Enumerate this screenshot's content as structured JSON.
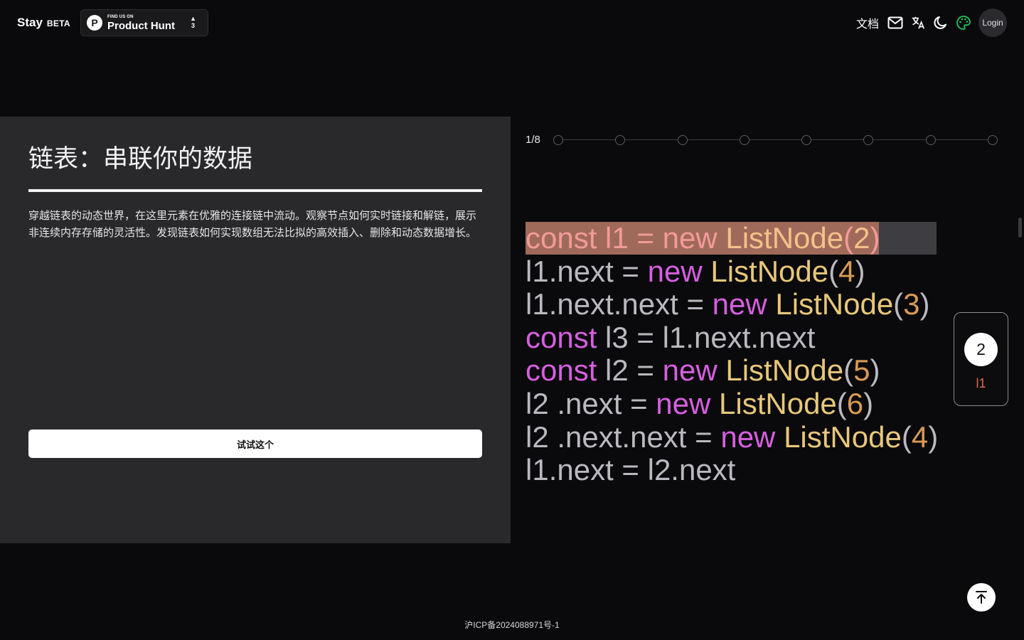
{
  "header": {
    "brand": "Stay",
    "beta": "BETA",
    "product_hunt": {
      "small": "FIND US ON",
      "big": "Product Hunt",
      "logo": "P",
      "arrow": "▲",
      "votes": "3"
    },
    "nav": {
      "docs": "文档",
      "login": "Login"
    },
    "icons": [
      "mail-icon",
      "translate-icon",
      "moon-icon",
      "palette-icon"
    ]
  },
  "left": {
    "title": "链表：串联你的数据",
    "description": "穿越链表的动态世界，在这里元素在优雅的连接链中流动。观察节点如何实时链接和解链，展示非连续内存存储的灵活性。发现链表如何实现数组无法比拟的高效插入、删除和动态数据增长。",
    "try_button": "试试这个"
  },
  "stepper": {
    "label": "1/8",
    "total": 8,
    "current": 1
  },
  "code": [
    [
      [
        "kw",
        "const"
      ],
      [
        "plain",
        " l1 = "
      ],
      [
        "kw",
        "new"
      ],
      [
        "plain",
        " "
      ],
      [
        "cls",
        "ListNode"
      ],
      [
        "plain",
        "("
      ],
      [
        "num",
        "2"
      ],
      [
        "plain",
        ")"
      ]
    ],
    [
      [
        "plain",
        "l1.next = "
      ],
      [
        "kw",
        "new"
      ],
      [
        "plain",
        " "
      ],
      [
        "cls",
        "ListNode"
      ],
      [
        "plain",
        "("
      ],
      [
        "num",
        "4"
      ],
      [
        "plain",
        ")"
      ]
    ],
    [
      [
        "plain",
        "l1.next.next = "
      ],
      [
        "kw",
        "new"
      ],
      [
        "plain",
        " "
      ],
      [
        "cls",
        "ListNode"
      ],
      [
        "plain",
        "("
      ],
      [
        "num",
        "3"
      ],
      [
        "plain",
        ")"
      ]
    ],
    [
      [
        "kw",
        "const"
      ],
      [
        "plain",
        " l3 = l1.next.next"
      ]
    ],
    [
      [
        "kw",
        "const"
      ],
      [
        "plain",
        " l2 = "
      ],
      [
        "kw",
        "new"
      ],
      [
        "plain",
        " "
      ],
      [
        "cls",
        "ListNode"
      ],
      [
        "plain",
        "("
      ],
      [
        "num",
        "5"
      ],
      [
        "plain",
        ")"
      ]
    ],
    [
      [
        "plain",
        "l2 .next = "
      ],
      [
        "kw",
        "new"
      ],
      [
        "plain",
        " "
      ],
      [
        "cls",
        "ListNode"
      ],
      [
        "plain",
        "("
      ],
      [
        "num",
        "6"
      ],
      [
        "plain",
        ")"
      ]
    ],
    [
      [
        "plain",
        "l2 .next.next = "
      ],
      [
        "kw",
        "new"
      ],
      [
        "plain",
        " "
      ],
      [
        "cls",
        "ListNode"
      ],
      [
        "plain",
        "("
      ],
      [
        "num",
        "4"
      ],
      [
        "plain",
        ")"
      ]
    ],
    [
      [
        "plain",
        "l1.next = l2.next"
      ]
    ]
  ],
  "highlight_line": 0,
  "node": {
    "value": "2",
    "label": "l1"
  },
  "footer": "沪ICP备2024088971号-1",
  "colors": {
    "keyword": "#d65fe0",
    "class": "#e8c77a",
    "number": "#d89a55",
    "node_label": "#e06a4a"
  }
}
